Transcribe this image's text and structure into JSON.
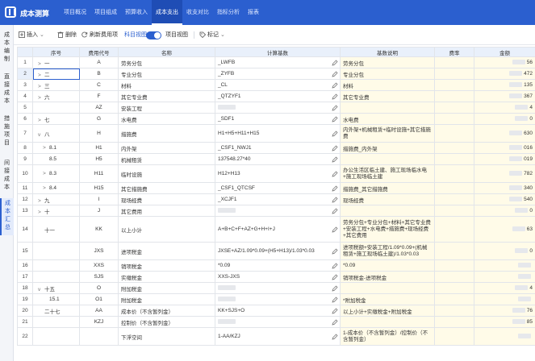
{
  "app": {
    "brand": "成本测算",
    "nav_tabs": [
      "项目概况",
      "项目组成",
      "预算收入",
      "成本支出",
      "收支对比",
      "指标分析",
      "报表"
    ],
    "active_tab_index": 3
  },
  "sidebar": {
    "items": [
      {
        "label": "成本编制",
        "active": false
      },
      {
        "label": "直接成本",
        "active": false
      },
      {
        "label": "措施项目",
        "active": false
      },
      {
        "label": "间接成本",
        "active": false
      },
      {
        "label": "成本汇总",
        "active": true
      }
    ]
  },
  "toolbar": {
    "insert": "插入",
    "delete": "删除",
    "refresh_cost": "刷新费用项",
    "subject_view": "科目视图",
    "project_view": "项目视图",
    "mark": "标记",
    "view_toggle_on": true
  },
  "table": {
    "headers": [
      "序号",
      "费用代号",
      "名称",
      "计算基数",
      "基数说明",
      "费率",
      "金额"
    ],
    "rows": [
      {
        "row": "1",
        "seq": "一",
        "caret": ">",
        "code": "A",
        "name": "劳务分包",
        "formula": "_LWFB",
        "basis": "劳务分包",
        "amount": "56"
      },
      {
        "row": "2",
        "seq": "二",
        "caret": ">",
        "code": "B",
        "name": "专业分包",
        "formula": "_ZYFB",
        "basis": "专业分包",
        "amount": "472"
      },
      {
        "row": "3",
        "seq": "三",
        "caret": ">",
        "code": "C",
        "name": "材料",
        "formula": "_CL",
        "basis": "材料",
        "amount": "135"
      },
      {
        "row": "4",
        "seq": "六",
        "caret": ">",
        "code": "F",
        "name": "其它专业费",
        "formula": "_QTZYF1",
        "basis": "其它专业费",
        "amount": "367"
      },
      {
        "row": "5",
        "seq": "",
        "caret": "",
        "code": "AZ",
        "name": "安装工程",
        "formula": "",
        "basis": "",
        "amount": "4"
      },
      {
        "row": "6",
        "seq": "七",
        "caret": ">",
        "code": "G",
        "name": "水电费",
        "formula": "_SDF1",
        "basis": "水电费",
        "amount": "0"
      },
      {
        "row": "7",
        "seq": "八",
        "caret": "v",
        "code": "H",
        "name": "措施费",
        "formula": "H1+H5+H11+H15",
        "basis": "内外架+机械租赁+临时设施+其它措施费",
        "amount": "630"
      },
      {
        "row": "8",
        "seq": "8.1",
        "caret": ">",
        "code": "H1",
        "name": "内外架",
        "formula": "_CSF1_NWJ1",
        "basis": "措施费_内外架",
        "amount": "016"
      },
      {
        "row": "9",
        "seq": "8.5",
        "caret": "",
        "code": "H5",
        "name": "机械租赁",
        "formula": "137548.27*40",
        "basis": "",
        "amount": "019"
      },
      {
        "row": "10",
        "seq": "8.3",
        "caret": ">",
        "code": "H11",
        "name": "临时设施",
        "formula": "H12+H13",
        "basis": "办公生活区临土建、施工现场临水电+施工现场临土建",
        "amount": "782"
      },
      {
        "row": "11",
        "seq": "8.4",
        "caret": ">",
        "code": "H15",
        "name": "其它措施费",
        "formula": "_CSF1_QTCSF",
        "basis": "措施费_其它措施费",
        "amount": "340"
      },
      {
        "row": "12",
        "seq": "九",
        "caret": ">",
        "code": "I",
        "name": "现场经费",
        "formula": "_XCJF1",
        "basis": "现场经费",
        "amount": "540"
      },
      {
        "row": "13",
        "seq": "十",
        "caret": ">",
        "code": "J",
        "name": "其它费用",
        "formula": "",
        "basis": "",
        "amount": "0"
      },
      {
        "row": "14",
        "seq": "十一",
        "caret": "",
        "code": "KK",
        "name": "以上小计",
        "formula": "A+B+C+F+AZ+G+H+I+J",
        "basis": "劳务分包+专业分包+材料+其它专业费+安装工程+水电费+措施费+现场经费+其它费用",
        "amount": "63"
      },
      {
        "row": "15",
        "seq": "",
        "caret": "",
        "code": "JXS",
        "name": "进项税金",
        "formula": "JXSE+AZ/1.09*0.09+(H5+H13)/1.03*0.03",
        "basis": "进项税额+安装工程/1.09*0.09+(机械租赁+施工现场临土建)/1.03*0.03",
        "amount": "0"
      },
      {
        "row": "16",
        "seq": "",
        "caret": "",
        "code": "XXS",
        "name": "销项税金",
        "formula": "*0.09",
        "basis": "*0.09",
        "amount": ""
      },
      {
        "row": "17",
        "seq": "",
        "caret": "",
        "code": "SJS",
        "name": "实缴税金",
        "formula": "XXS-JXS",
        "basis": "销项税金-进项税金",
        "amount": ""
      },
      {
        "row": "18",
        "seq": "十五",
        "caret": "v",
        "code": "O",
        "name": "附加税金",
        "formula": "",
        "basis": "",
        "amount": "4"
      },
      {
        "row": "19",
        "seq": "15.1",
        "caret": "",
        "code": "O1",
        "name": "附加税金",
        "formula": "",
        "basis": "*附加税金",
        "amount": ""
      },
      {
        "row": "20",
        "seq": "二十七",
        "caret": "",
        "code": "AA",
        "name": "成本价（不含暂列金）",
        "formula": "KK+SJS+O",
        "basis": "以上小计+实缴税金+附加税金",
        "amount": "76"
      },
      {
        "row": "21",
        "seq": "",
        "caret": "",
        "code": "KZJ",
        "name": "控制价（不含暂列金）",
        "formula": "",
        "basis": "",
        "amount": "85"
      },
      {
        "row": "22",
        "seq": "",
        "caret": "",
        "code": "",
        "name": "下浮空间",
        "formula": "1-AA/KZJ",
        "basis": "1-成本价（不含暂列金）/控制价（不含暂列金）",
        "amount": ""
      }
    ]
  }
}
